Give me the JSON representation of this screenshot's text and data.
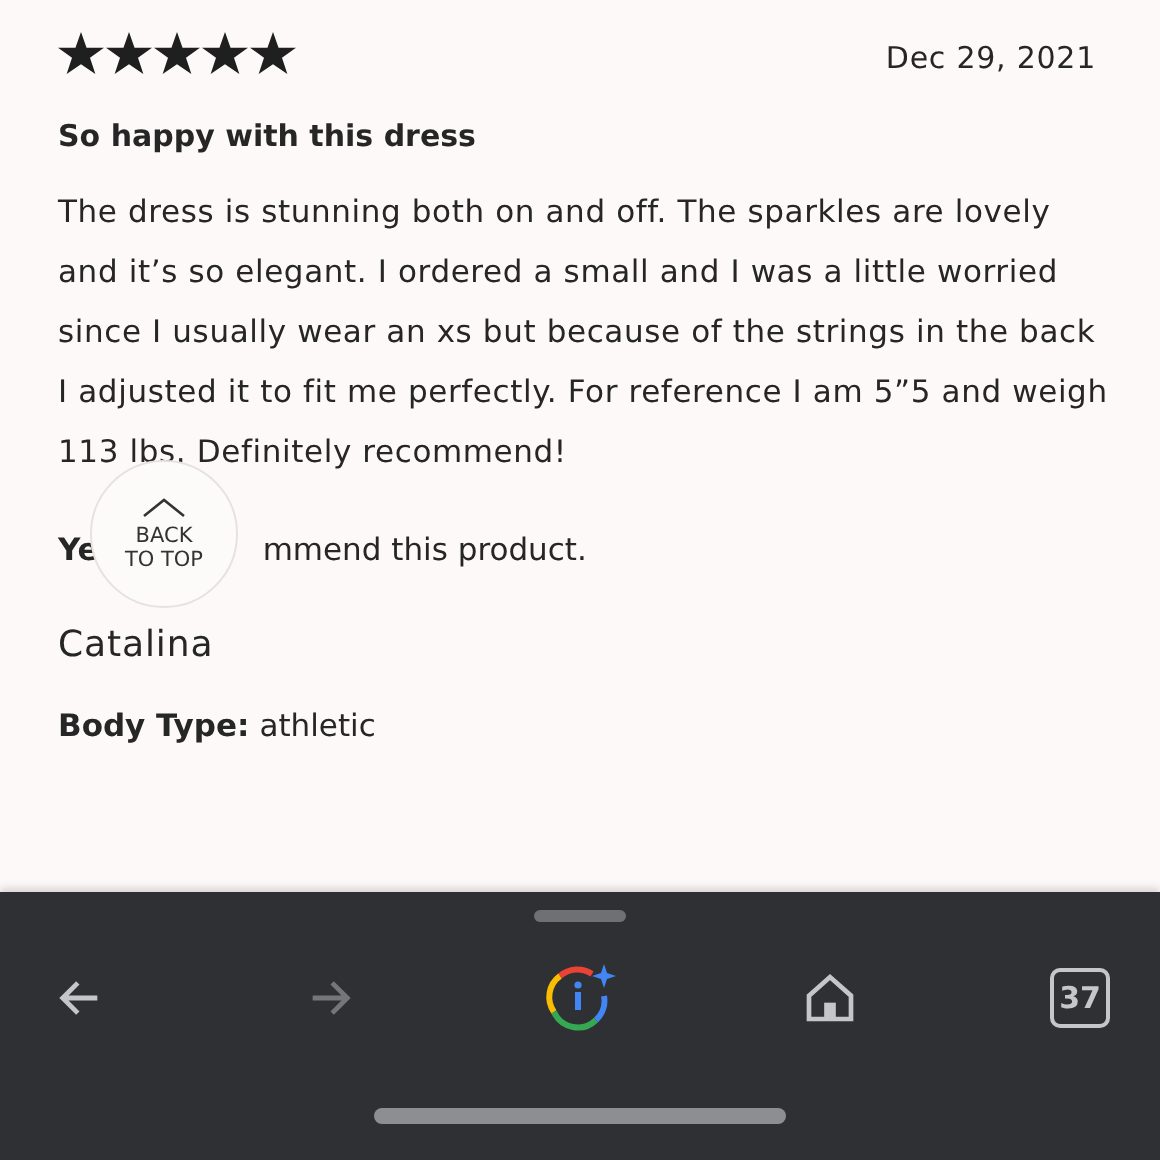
{
  "review": {
    "stars": 5,
    "date": "Dec 29, 2021",
    "title": "So happy with this dress",
    "body": "The dress is stunning both on and off. The sparkles are lovely and it’s so elegant. I ordered a small and I was a little worried since I usually wear an xs but because of the strings in the back I adjusted it to fit me perfectly. For reference I am 5”5 and weigh 113 lbs. Definitely recommend!",
    "recommend_start": "Ye",
    "recommend_end": "mmend this product.",
    "author": "Catalina",
    "body_type_label": "Body Type:",
    "body_type": "athletic"
  },
  "back_to_top": {
    "line_1": "BACK",
    "line_2": "TO TOP"
  },
  "toolbar": {
    "items": [
      {
        "kind": "back",
        "disabled": false
      },
      {
        "kind": "forward",
        "disabled": true
      },
      {
        "kind": "lens",
        "disabled": false
      },
      {
        "kind": "home",
        "disabled": false
      },
      {
        "kind": "tabs",
        "label": "37",
        "disabled": false
      }
    ]
  }
}
